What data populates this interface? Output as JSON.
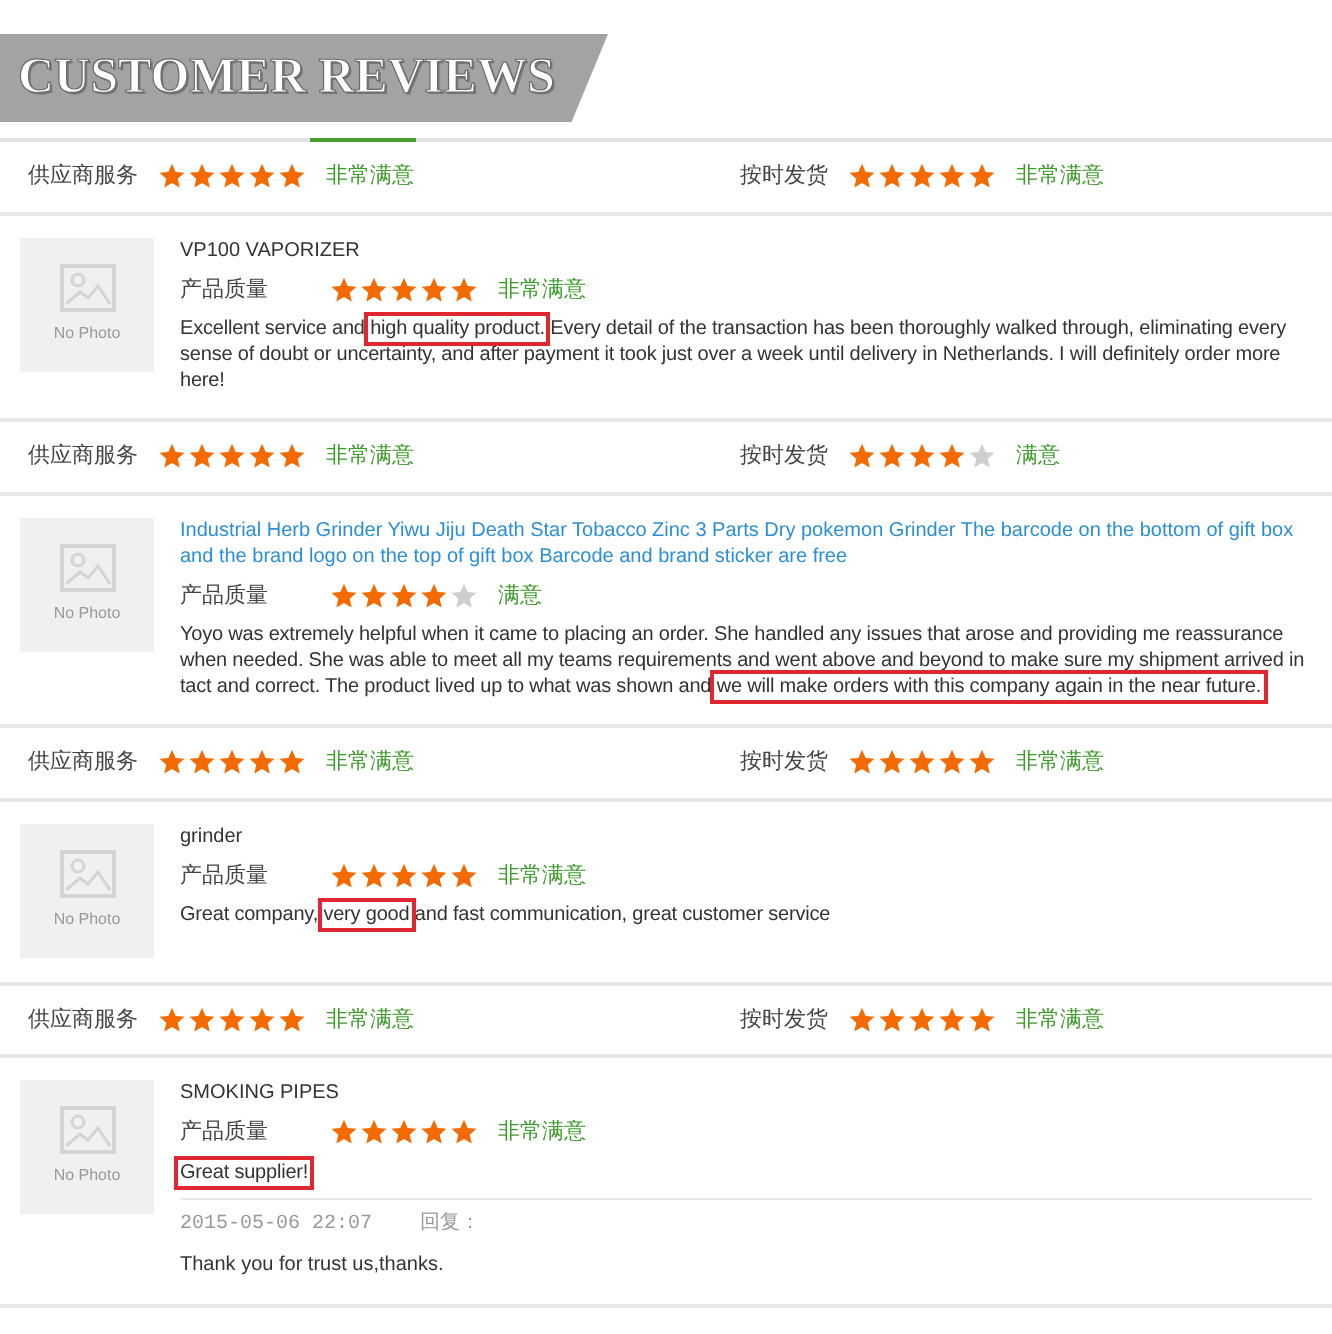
{
  "header": {
    "title": "CUSTOMER REVIEWS",
    "tab_indicator": true
  },
  "entries": [
    {
      "kind": "ratings",
      "items": [
        {
          "label": "供应商服务",
          "stars": 5,
          "verdict": "非常满意"
        },
        {
          "label": "按时发货",
          "stars": 5,
          "verdict": "非常满意"
        }
      ]
    },
    {
      "kind": "review",
      "photo": "No Photo",
      "title": "VP100 VAPORIZER",
      "title_is_link": false,
      "rating": {
        "label": "产品质量",
        "stars": 5,
        "verdict": "非常满意"
      },
      "comment": [
        {
          "text": "Excellent service and ",
          "highlighted": false
        },
        {
          "text": "high quality product.",
          "highlighted": true
        },
        {
          "text": " Every detail of the transaction has been thoroughly walked through, eliminating every sense of doubt or uncertainty, and after payment it took just over a week until delivery in Netherlands. I will definitely order more here!",
          "highlighted": false
        }
      ]
    },
    {
      "kind": "ratings",
      "items": [
        {
          "label": "供应商服务",
          "stars": 5,
          "verdict": "非常满意"
        },
        {
          "label": "按时发货",
          "stars": 4,
          "verdict": "满意"
        }
      ]
    },
    {
      "kind": "review",
      "photo": "No Photo",
      "title": "Industrial Herb Grinder Yiwu Jiju Death Star Tobacco Zinc 3 Parts Dry pokemon Grinder The barcode on the bottom of gift box and the brand logo on the top of gift box Barcode and brand sticker are free",
      "title_is_link": true,
      "rating": {
        "label": "产品质量",
        "stars": 4,
        "verdict": "满意"
      },
      "comment": [
        {
          "text": "Yoyo was extremely helpful when it came to placing an order. She handled any issues that arose and providing me reassurance when needed. She was able to meet all my teams requirements and went above and beyond to make sure my shipment arrived in tact and correct. The product lived up to what was shown and ",
          "highlighted": false
        },
        {
          "text": "we will make orders with this company again in the near future.",
          "highlighted": true
        }
      ]
    },
    {
      "kind": "ratings",
      "items": [
        {
          "label": "供应商服务",
          "stars": 5,
          "verdict": "非常满意"
        },
        {
          "label": "按时发货",
          "stars": 5,
          "verdict": "非常满意"
        }
      ]
    },
    {
      "kind": "review",
      "photo": "No Photo",
      "title": "grinder",
      "title_is_link": false,
      "rating": {
        "label": "产品质量",
        "stars": 5,
        "verdict": "非常满意"
      },
      "comment": [
        {
          "text": "Great company, ",
          "highlighted": false
        },
        {
          "text": "very good",
          "highlighted": true
        },
        {
          "text": " and fast communication, great customer service",
          "highlighted": false
        }
      ]
    },
    {
      "kind": "ratings",
      "items": [
        {
          "label": "供应商服务",
          "stars": 5,
          "verdict": "非常满意"
        },
        {
          "label": "按时发货",
          "stars": 5,
          "verdict": "非常满意"
        }
      ]
    },
    {
      "kind": "review",
      "photo": "No Photo",
      "title": "SMOKING PIPES",
      "title_is_link": false,
      "rating": {
        "label": "产品质量",
        "stars": 5,
        "verdict": "非常满意"
      },
      "comment": [
        {
          "text": "Great supplier!",
          "highlighted": true
        }
      ],
      "reply": {
        "date": "2015-05-06 22:07",
        "label": "回复：",
        "text": "Thank you for trust us,thanks."
      }
    }
  ]
}
